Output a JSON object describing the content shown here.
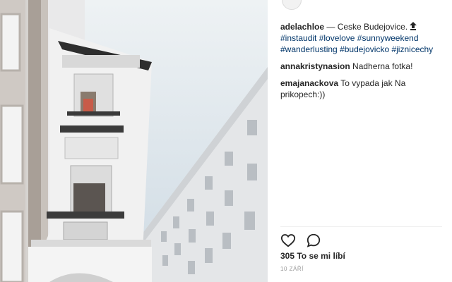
{
  "post": {
    "author": "adelachloe",
    "separator": " — ",
    "caption": "Ceske Budejovice.",
    "badge_icon": "upload-arrow-icon",
    "hashtags": [
      "#instaudit",
      "#lovelove",
      "#sunnyweekend",
      "#wanderlusting",
      "#budejovicko",
      "#jiznicechy"
    ]
  },
  "comments": [
    {
      "user": "annakristynasion",
      "text": "Nadherna fotka!"
    },
    {
      "user": "emajanackova",
      "text": "To vypada jak Na prikopech:))"
    }
  ],
  "actions": {
    "like_icon": "heart-icon",
    "comment_icon": "speech-bubble-icon"
  },
  "likes": "305 To se mi líbí",
  "date": "10 ZÁŘÍ",
  "colors": {
    "hashtag": "#003569",
    "text": "#262626",
    "meta": "#999999",
    "sky": "#d9e3ea"
  }
}
